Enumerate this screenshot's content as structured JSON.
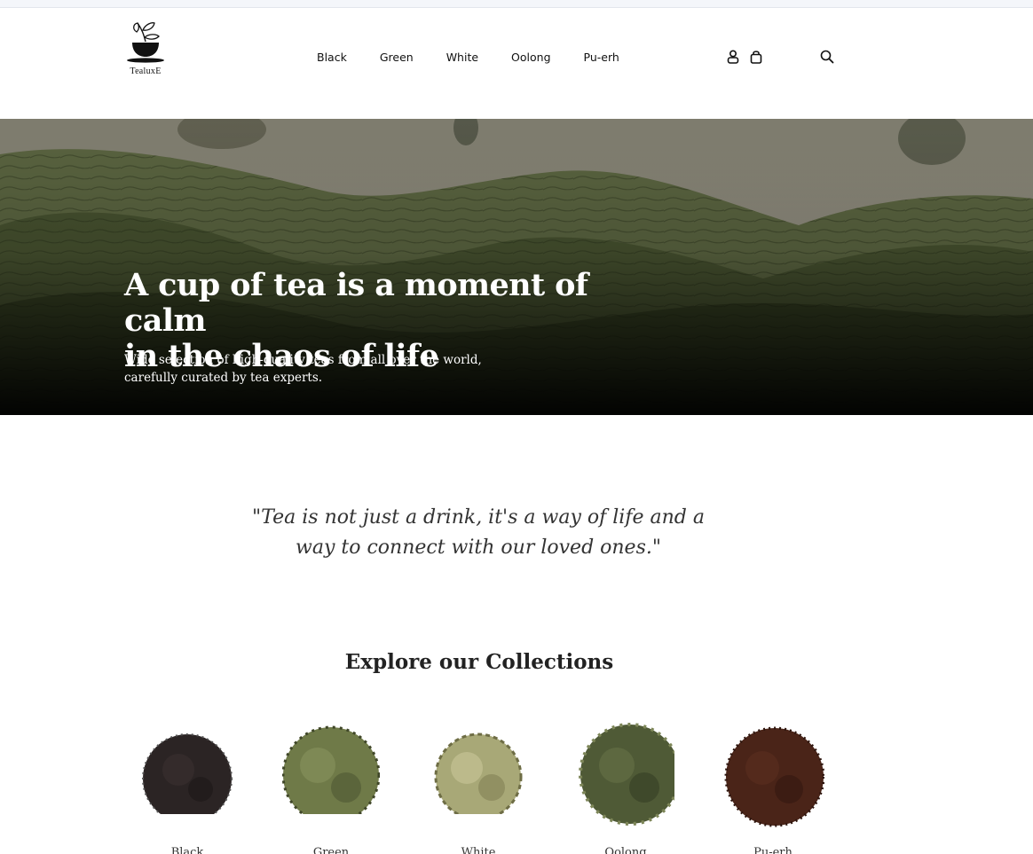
{
  "brand": {
    "logo_text": "TealuxE"
  },
  "nav": {
    "items": [
      "Black",
      "Green",
      "White",
      "Oolong",
      "Pu-erh"
    ]
  },
  "icons": {
    "account": "user-icon",
    "cart": "shopping-bag-icon",
    "search": "search-icon"
  },
  "hero": {
    "title_line1": "A cup of tea is a moment of calm",
    "title_line2": "in the chaos of life",
    "subtitle_line1": "Wide selection of high-quality teas from all over the world,",
    "subtitle_line2": "carefully curated by tea experts."
  },
  "quote": {
    "line1": "\"Tea is not just a drink, it's a way of life and a",
    "line2": "way to connect with our loved ones.\""
  },
  "collections": {
    "title": "Explore our Collections",
    "items": [
      {
        "label": "Black",
        "color": "#2b2424"
      },
      {
        "label": "Green",
        "color": "#6f7a48"
      },
      {
        "label": "White",
        "color": "#a8a877"
      },
      {
        "label": "Oolong",
        "color": "#4f5a36"
      },
      {
        "label": "Pu-erh",
        "color": "#4a2418"
      }
    ]
  }
}
